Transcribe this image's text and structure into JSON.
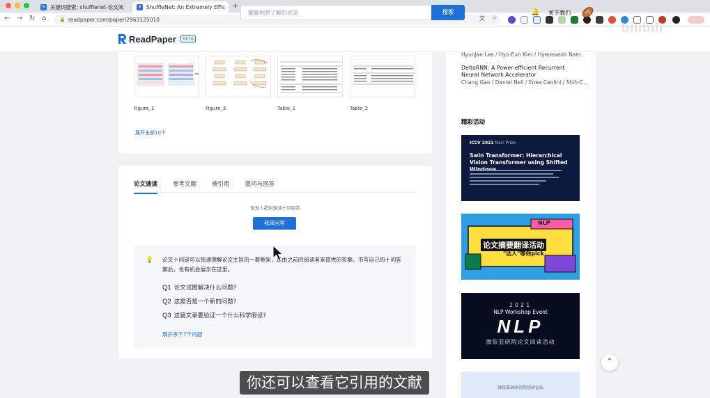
{
  "browser": {
    "tabs": [
      {
        "label": "关键词搜索: shufflenet-论文阅"
      },
      {
        "label": "ShuffleNet: An Extremely Effic"
      }
    ],
    "url": "readpaper.com/paper/2963125010"
  },
  "header": {
    "logo_text": "ReadPaper",
    "beta": "BETA",
    "search_placeholder": "搜索你想了解的论文",
    "search_button": "搜索",
    "about": "关于我们"
  },
  "figures": {
    "items": [
      {
        "label": "Figure_1"
      },
      {
        "label": "Figure_2"
      },
      {
        "label": "Table_1"
      },
      {
        "label": "Table_2"
      }
    ],
    "expand_all": "展开全部10个"
  },
  "tabs": [
    {
      "label": "论文速读"
    },
    {
      "label": "参考文献"
    },
    {
      "label": "被引用"
    },
    {
      "label": "提问与回答"
    }
  ],
  "qa": {
    "hint": "暂无人提供速读十问回答",
    "answer_button": "我来回答",
    "intro": "论文十问是可以快速理解论文主旨的一套框架，是由之前的阅读者来提供的答案。书写自己的十问答案后，也有机会展示在这里。",
    "questions": [
      {
        "num": "Q1",
        "text": "论文试图解决什么问题?"
      },
      {
        "num": "Q2",
        "text": "这是否是一个新的问题?"
      },
      {
        "num": "Q3",
        "text": "这篇文章要验证一个什么科学假设?"
      }
    ],
    "expand_more": "展开余下7个问题"
  },
  "sidebar": {
    "authors_1": "HyunJae Lee / Hyo-Eun Kim / Hyeonseob Nam",
    "paper_2_title": "DeltaRNN: A Power-efficient Recurrent Neural Network Accelerator",
    "authors_2": "Chang Gao / Daniel Neil / Enea Ceolini / Shih-C...",
    "section_title": "精彩活动",
    "banner_1": {
      "tag": "ICCV 2021",
      "tag2": "Marr Prize",
      "title": "Swin Transformer: Hierarchical Vision Transformer using Shifted Windows"
    },
    "banner_2": {
      "big": "论文摘要翻译活动",
      "sub": "\"达人\"等你pick",
      "corner": "NLP"
    },
    "banner_3": {
      "year": "2021",
      "event": "NLP Workshop Event",
      "big": "NLP",
      "sub": "微软亚研院论文阅读活动"
    },
    "banner_4": {
      "sub": "微软亚洲研究院创研论坛"
    }
  },
  "subtitle": "你还可以查看它引用的文献",
  "colors": {
    "accent": "#1e6fd9"
  }
}
